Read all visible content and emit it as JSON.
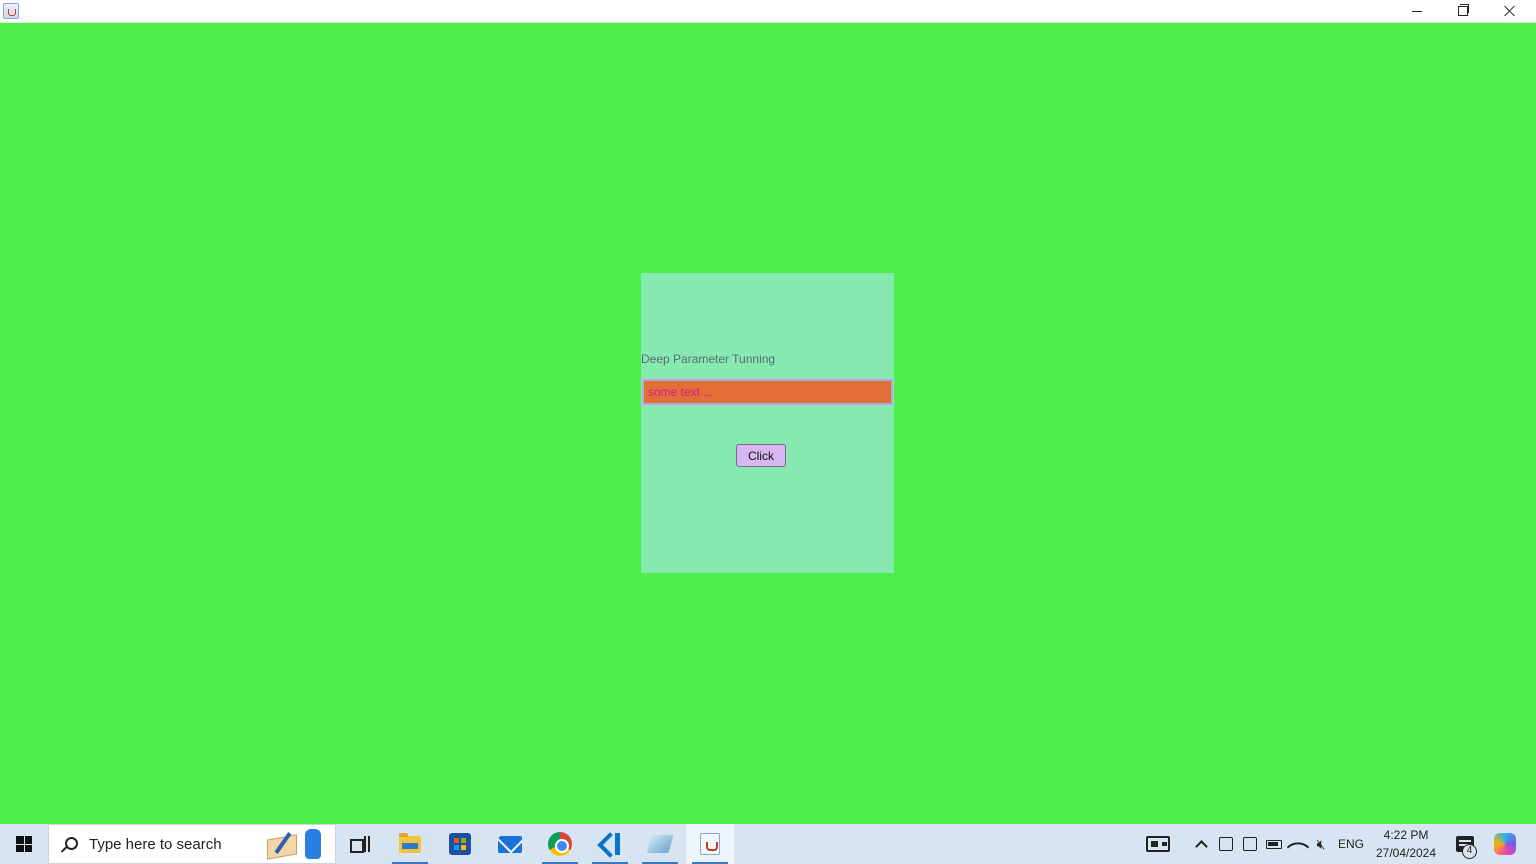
{
  "window": {
    "title": "",
    "controls": {
      "minimize": "minimize",
      "maximize": "restore",
      "close": "close"
    }
  },
  "panel": {
    "label": "Deep Parameter Tunning",
    "text_field": {
      "value": "",
      "placeholder": "some text ..."
    },
    "button_label": "Click"
  },
  "taskbar": {
    "search_placeholder": "Type here to search",
    "pinned": [
      "task-view-icon",
      "file-explorer-icon",
      "microsoft-store-icon",
      "mail-icon",
      "chrome-icon",
      "vscode-icon",
      "notes-app-icon",
      "java-app-icon"
    ],
    "tray": {
      "language": "ENG",
      "time": "4:22 PM",
      "date": "27/04/2024",
      "notification_count": "4"
    }
  },
  "colors": {
    "window_background": "#4cee4c",
    "panel_background": "#86eab0",
    "field_background": "#e26f37",
    "field_text": "#d81b8a",
    "button_background": "#d8b6f2"
  }
}
